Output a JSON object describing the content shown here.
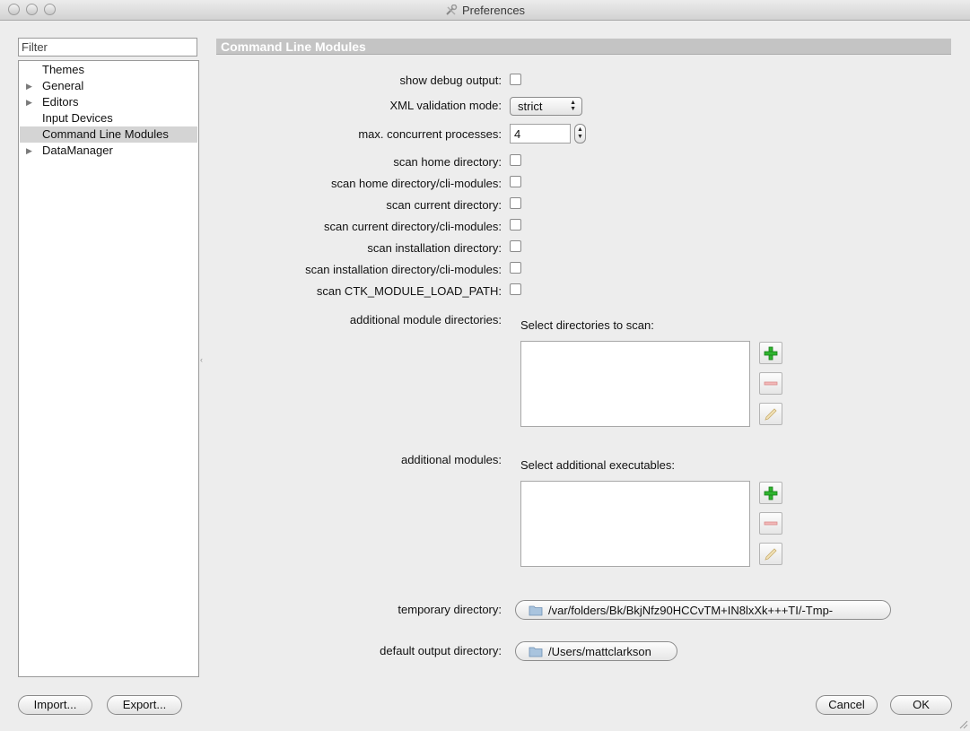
{
  "window": {
    "title": "Preferences"
  },
  "sidebar": {
    "filter_placeholder": "Filter",
    "items": [
      {
        "label": "Themes",
        "expandable": false
      },
      {
        "label": "General",
        "expandable": true
      },
      {
        "label": "Editors",
        "expandable": true
      },
      {
        "label": "Input Devices",
        "expandable": false
      },
      {
        "label": "Command Line Modules",
        "expandable": false,
        "selected": true
      },
      {
        "label": "DataManager",
        "expandable": true
      }
    ]
  },
  "page": {
    "title": "Command Line Modules",
    "fields": {
      "show_debug_output": "show debug output:",
      "xml_validation_mode": "XML validation mode:",
      "xml_validation_value": "strict",
      "max_concurrent": "max. concurrent processes:",
      "max_concurrent_value": "4",
      "scan_home": "scan home directory:",
      "scan_home_cli": "scan home directory/cli-modules:",
      "scan_current": "scan current directory:",
      "scan_current_cli": "scan current directory/cli-modules:",
      "scan_install": "scan installation directory:",
      "scan_install_cli": "scan installation directory/cli-modules:",
      "scan_ctk_path": "scan CTK_MODULE_LOAD_PATH:",
      "additional_dirs": "additional module directories:",
      "additional_dirs_sub": "Select directories to scan:",
      "additional_modules": "additional modules:",
      "additional_modules_sub": "Select additional executables:",
      "temp_dir": "temporary directory:",
      "temp_dir_value": "/var/folders/Bk/BkjNfz90HCCvTM+IN8lxXk+++TI/-Tmp-",
      "output_dir": "default output directory:",
      "output_dir_value": "/Users/mattclarkson"
    }
  },
  "buttons": {
    "import": "Import...",
    "export": "Export...",
    "cancel": "Cancel",
    "ok": "OK"
  }
}
